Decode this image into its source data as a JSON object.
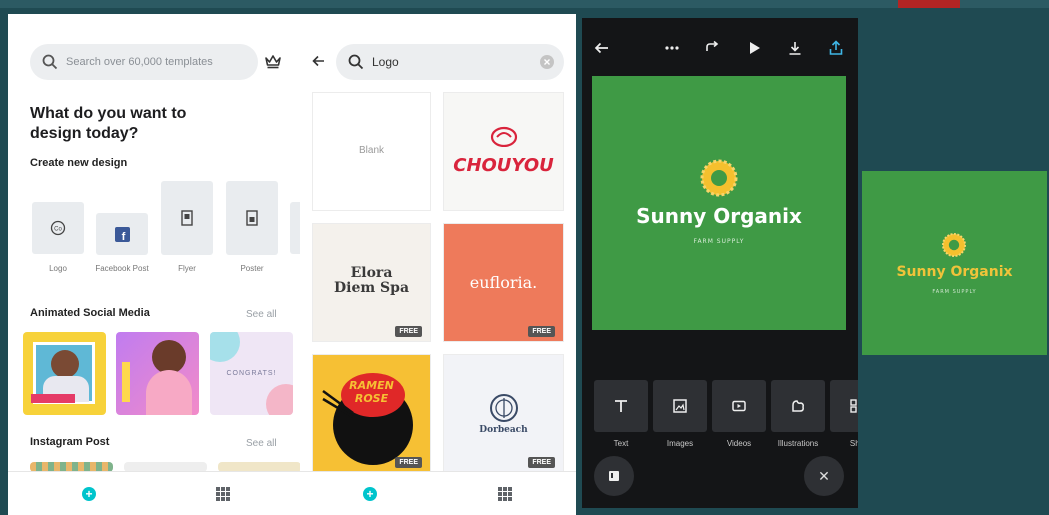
{
  "colors": {
    "accent": "#00c4cc",
    "canvas_green": "#3f9a45",
    "editor_bg": "#141517",
    "sun": "#f5c02e"
  },
  "home": {
    "search_placeholder": "Search over 60,000 templates",
    "heading": "What do you want to design today?",
    "create_title": "Create new design",
    "designs": [
      {
        "label": "Logo"
      },
      {
        "label": "Facebook Post"
      },
      {
        "label": "Flyer"
      },
      {
        "label": "Poster"
      }
    ],
    "animated_title": "Animated Social Media",
    "animated_see_all": "See all",
    "animated_thumbs": [
      {
        "text": ""
      },
      {
        "text": ""
      },
      {
        "text": "CONGRATS!"
      }
    ],
    "instagram_title": "Instagram Post",
    "instagram_see_all": "See all"
  },
  "search": {
    "query": "Logo",
    "templates": [
      {
        "name": "Blank",
        "badge": ""
      },
      {
        "name": "CHOUYOU",
        "badge": ""
      },
      {
        "name": "Elora Diem Spa",
        "line1": "Elora",
        "line2": "Diem Spa",
        "badge": "FREE"
      },
      {
        "name": "eufloria.",
        "badge": "FREE"
      },
      {
        "name": "RAMEN ROSE",
        "line1": "RAMEN",
        "line2": "ROSE",
        "badge": "FREE"
      },
      {
        "name": "Dorbeach",
        "badge": "FREE"
      }
    ]
  },
  "editor": {
    "brand_name": "Sunny Organix",
    "brand_tagline": "FARM SUPPLY",
    "tools": [
      {
        "label": "Text",
        "icon": "text-icon"
      },
      {
        "label": "Images",
        "icon": "image-icon"
      },
      {
        "label": "Videos",
        "icon": "video-icon"
      },
      {
        "label": "Illustrations",
        "icon": "illustration-icon"
      },
      {
        "label": "Sha",
        "icon": "shapes-icon"
      }
    ],
    "close_glyph": "✕"
  },
  "preview": {
    "brand_name": "Sunny Organix",
    "brand_tagline": "FARM SUPPLY"
  }
}
